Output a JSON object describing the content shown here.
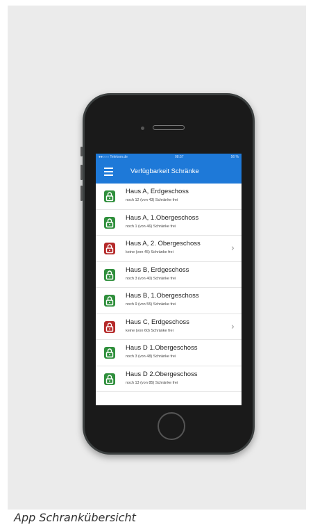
{
  "caption": "App Schranküb ersicht",
  "status": {
    "carrier": "●●○○○ Telekom.de",
    "time": "08:57",
    "battery": "56 %"
  },
  "header": {
    "title": "Verfügbarkeit Schränke"
  },
  "colors": {
    "available": "#2f8f3c",
    "full": "#b52a2a",
    "navbar": "#1e79d8"
  },
  "rows": [
    {
      "title": "Haus A, Erdgeschoss",
      "subtitle": "noch 12 (von 43) Schränke frei",
      "status": "available",
      "chevron": ""
    },
    {
      "title": "Haus A, 1.Obergeschoss",
      "subtitle": "noch 1 (von 46) Schränke frei",
      "status": "available",
      "chevron": ""
    },
    {
      "title": "Haus A, 2. Obergeschoss",
      "subtitle": "keine (von 45) Schränke frei",
      "status": "full",
      "chevron": "›"
    },
    {
      "title": "Haus B, Erdgeschoss",
      "subtitle": "noch 3 (von 40) Schränke frei",
      "status": "available",
      "chevron": ""
    },
    {
      "title": "Haus B, 1.Obergeschoss",
      "subtitle": "noch 9 (von 55) Schränke frei",
      "status": "available",
      "chevron": ""
    },
    {
      "title": "Haus C, Erdgeschoss",
      "subtitle": "keine (von 60) Schränke frei",
      "status": "full",
      "chevron": "›"
    },
    {
      "title": "Haus D 1.Obergeschoss",
      "subtitle": "noch 3 (von 48) Schränke frei",
      "status": "available",
      "chevron": ""
    },
    {
      "title": "Haus D 2.Obergeschoss",
      "subtitle": "noch 13 (von 85) Schränke frei",
      "status": "available",
      "chevron": ""
    }
  ]
}
